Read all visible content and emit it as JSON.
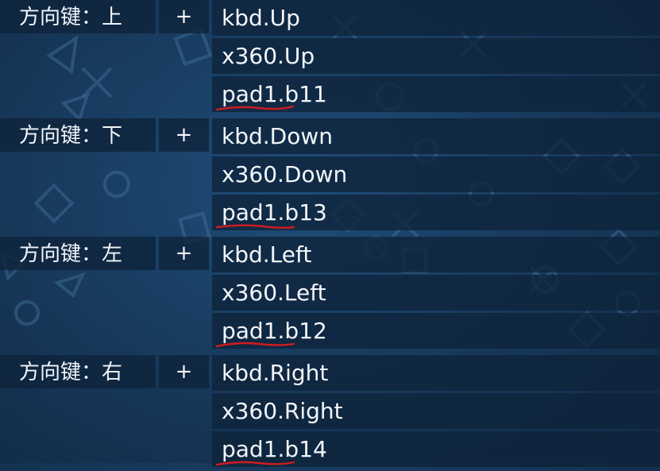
{
  "colors": {
    "background": "#17385a",
    "cell": "#0e233a",
    "text": "#f2f6fa",
    "annotation": "#d01c20"
  },
  "groups": [
    {
      "action": "方向键：上",
      "add_label": "+",
      "bindings": [
        "kbd.Up",
        "x360.Up",
        "pad1.b11"
      ]
    },
    {
      "action": "方向键：下",
      "add_label": "+",
      "bindings": [
        "kbd.Down",
        "x360.Down",
        "pad1.b13"
      ]
    },
    {
      "action": "方向键：左",
      "add_label": "+",
      "bindings": [
        "kbd.Left",
        "x360.Left",
        "pad1.b12"
      ]
    },
    {
      "action": "方向键：右",
      "add_label": "+",
      "bindings": [
        "kbd.Right",
        "x360.Right",
        "pad1.b14"
      ]
    }
  ]
}
